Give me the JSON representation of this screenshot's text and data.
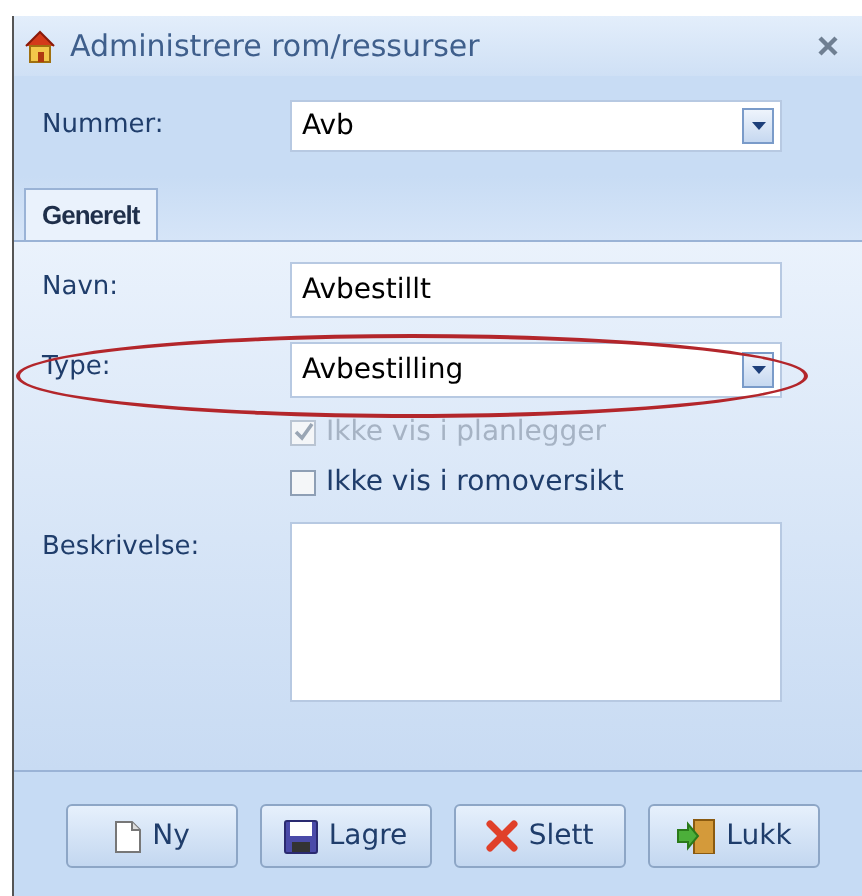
{
  "window": {
    "title": "Administrere rom/ressurser"
  },
  "nummer": {
    "label": "Nummer:",
    "value": "Avb"
  },
  "tabs": [
    {
      "label": "Generelt",
      "selected": true
    }
  ],
  "fields": [
    {
      "kind": "text",
      "label": "Navn:",
      "value": "Avbestillt"
    },
    {
      "kind": "dropdown",
      "label": "Type:",
      "value": "Avbestilling",
      "highlighted": true
    }
  ],
  "checkboxes": [
    {
      "label": "Ikke vis i planlegger",
      "checked": true,
      "disabled": true
    },
    {
      "label": "Ikke vis i romoversikt",
      "checked": false,
      "disabled": false
    }
  ],
  "description": {
    "label": "Beskrivelse:"
  },
  "buttons": [
    {
      "kind": "new",
      "label": "Ny"
    },
    {
      "kind": "save",
      "label": "Lagre"
    },
    {
      "kind": "delete",
      "label": "Slett"
    },
    {
      "kind": "close",
      "label": "Lukk"
    }
  ]
}
